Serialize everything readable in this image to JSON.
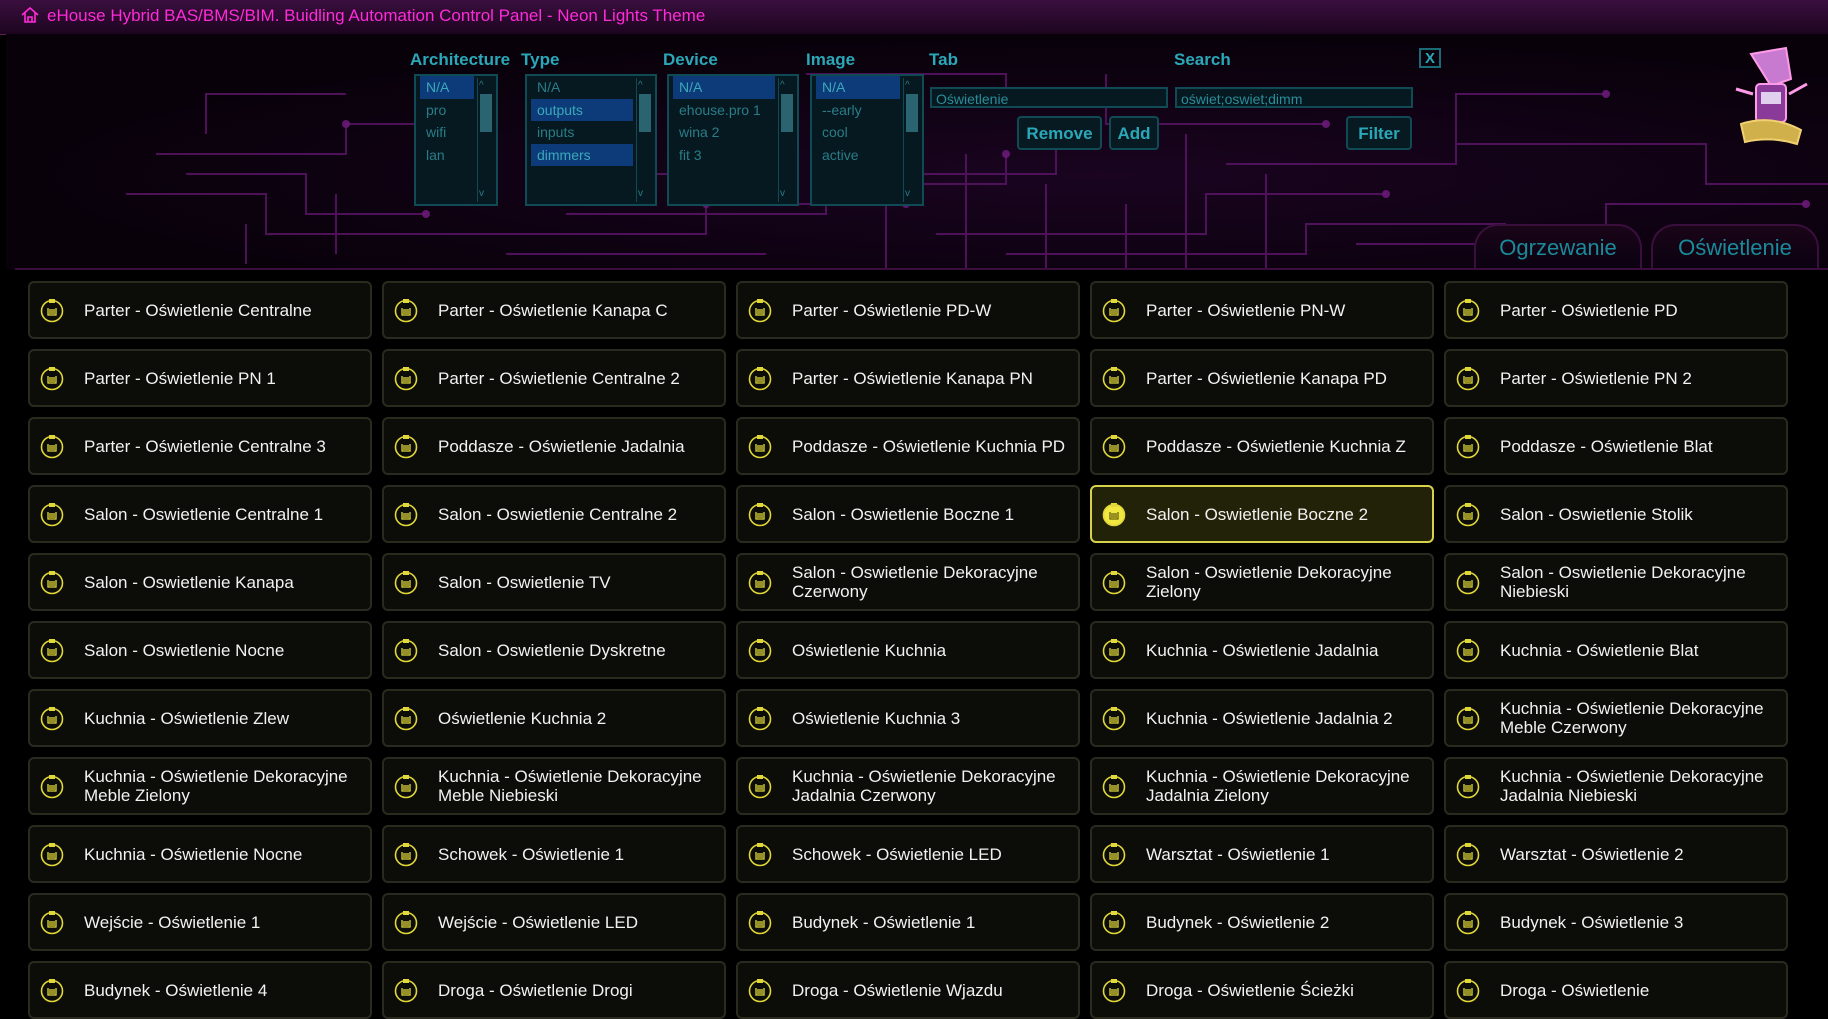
{
  "app": {
    "title": "eHouse Hybrid BAS/BMS/BIM. Buidling Automation Control Panel - Neon Lights Theme",
    "home_icon": "home-icon"
  },
  "filters": {
    "architecture": {
      "label": "Architecture",
      "options": [
        "N/A",
        "pro",
        "wifi",
        "lan"
      ],
      "selected": [
        0
      ]
    },
    "type": {
      "label": "Type",
      "options": [
        "N/A",
        "outputs",
        "inputs",
        "dimmers"
      ],
      "selected": [
        1,
        3
      ]
    },
    "device": {
      "label": "Device",
      "options": [
        "N/A",
        "ehouse.pro 1",
        "wina 2",
        "fit 3"
      ],
      "selected": [
        0
      ]
    },
    "image": {
      "label": "Image",
      "options": [
        "N/A",
        "--early",
        "cool",
        "active"
      ],
      "selected": [
        0
      ]
    },
    "tab": {
      "label": "Tab",
      "value": "Oświetlenie"
    },
    "search": {
      "label": "Search",
      "value": "oświet;oswiet;dimm"
    },
    "remove_label": "Remove",
    "add_label": "Add",
    "filter_label": "Filter",
    "close_label": "X"
  },
  "tabs": [
    {
      "label": "Ogrzewanie",
      "active": false
    },
    {
      "label": "Oświetlenie",
      "active": true
    }
  ],
  "colors": {
    "accent": "#ff2ad8",
    "filter": "#2aa8b8",
    "tile_icon": "#e0d83a",
    "active_border": "#d8d24a"
  },
  "tiles": [
    {
      "label": "Parter - Oświetlenie Centralne"
    },
    {
      "label": "Parter - Oświetlenie Kanapa C"
    },
    {
      "label": "Parter - Oświetlenie PD-W"
    },
    {
      "label": "Parter - Oświetlenie PN-W"
    },
    {
      "label": "Parter - Oświetlenie PD"
    },
    {
      "label": "Parter - Oświetlenie PN 1"
    },
    {
      "label": "Parter - Oświetlenie Centralne 2"
    },
    {
      "label": "Parter - Oświetlenie Kanapa PN"
    },
    {
      "label": "Parter - Oświetlenie Kanapa PD"
    },
    {
      "label": "Parter - Oświetlenie PN 2"
    },
    {
      "label": "Parter - Oświetlenie Centralne 3"
    },
    {
      "label": "Poddasze - Oświetlenie Jadalnia"
    },
    {
      "label": "Poddasze - Oświetlenie Kuchnia PD"
    },
    {
      "label": "Poddasze - Oświetlenie Kuchnia Z"
    },
    {
      "label": "Poddasze - Oświetlenie Blat"
    },
    {
      "label": "Salon - Oswietlenie Centralne 1"
    },
    {
      "label": "Salon - Oswietlenie Centralne 2"
    },
    {
      "label": "Salon - Oswietlenie Boczne 1"
    },
    {
      "label": "Salon - Oswietlenie Boczne 2",
      "active": true
    },
    {
      "label": "Salon - Oswietlenie Stolik"
    },
    {
      "label": "Salon - Oswietlenie Kanapa"
    },
    {
      "label": "Salon - Oswietlenie TV"
    },
    {
      "label": "Salon - Oswietlenie Dekoracyjne Czerwony"
    },
    {
      "label": "Salon - Oswietlenie Dekoracyjne Zielony"
    },
    {
      "label": "Salon - Oswietlenie Dekoracyjne Niebieski"
    },
    {
      "label": "Salon - Oswietlenie Nocne"
    },
    {
      "label": "Salon - Oswietlenie Dyskretne"
    },
    {
      "label": "Oświetlenie Kuchnia"
    },
    {
      "label": "Kuchnia - Oświetlenie Jadalnia"
    },
    {
      "label": "Kuchnia - Oświetlenie Blat"
    },
    {
      "label": "Kuchnia - Oświetlenie Zlew"
    },
    {
      "label": "Oświetlenie Kuchnia 2"
    },
    {
      "label": "Oświetlenie Kuchnia 3"
    },
    {
      "label": "Kuchnia - Oświetlenie Jadalnia 2"
    },
    {
      "label": "Kuchnia - Oświetlenie Dekoracyjne Meble Czerwony"
    },
    {
      "label": "Kuchnia - Oświetlenie Dekoracyjne Meble Zielony"
    },
    {
      "label": "Kuchnia - Oświetlenie Dekoracyjne Meble Niebieski"
    },
    {
      "label": "Kuchnia - Oświetlenie Dekoracyjne Jadalnia Czerwony"
    },
    {
      "label": "Kuchnia - Oświetlenie Dekoracyjne Jadalnia Zielony"
    },
    {
      "label": "Kuchnia - Oświetlenie Dekoracyjne Jadalnia Niebieski"
    },
    {
      "label": "Kuchnia - Oświetlenie Nocne"
    },
    {
      "label": "Schowek - Oświetlenie 1"
    },
    {
      "label": "Schowek - Oświetlenie LED"
    },
    {
      "label": "Warsztat - Oświetlenie 1"
    },
    {
      "label": "Warsztat - Oświetlenie 2"
    },
    {
      "label": "Wejście - Oświetlenie 1"
    },
    {
      "label": "Wejście - Oświetlenie LED"
    },
    {
      "label": "Budynek - Oświetlenie 1"
    },
    {
      "label": "Budynek - Oświetlenie 2"
    },
    {
      "label": "Budynek - Oświetlenie 3"
    },
    {
      "label": "Budynek - Oświetlenie 4"
    },
    {
      "label": "Droga - Oświetlenie Drogi"
    },
    {
      "label": "Droga - Oświetlenie Wjazdu"
    },
    {
      "label": "Droga - Oświetlenie Ścieżki"
    },
    {
      "label": "Droga - Oświetlenie"
    }
  ]
}
